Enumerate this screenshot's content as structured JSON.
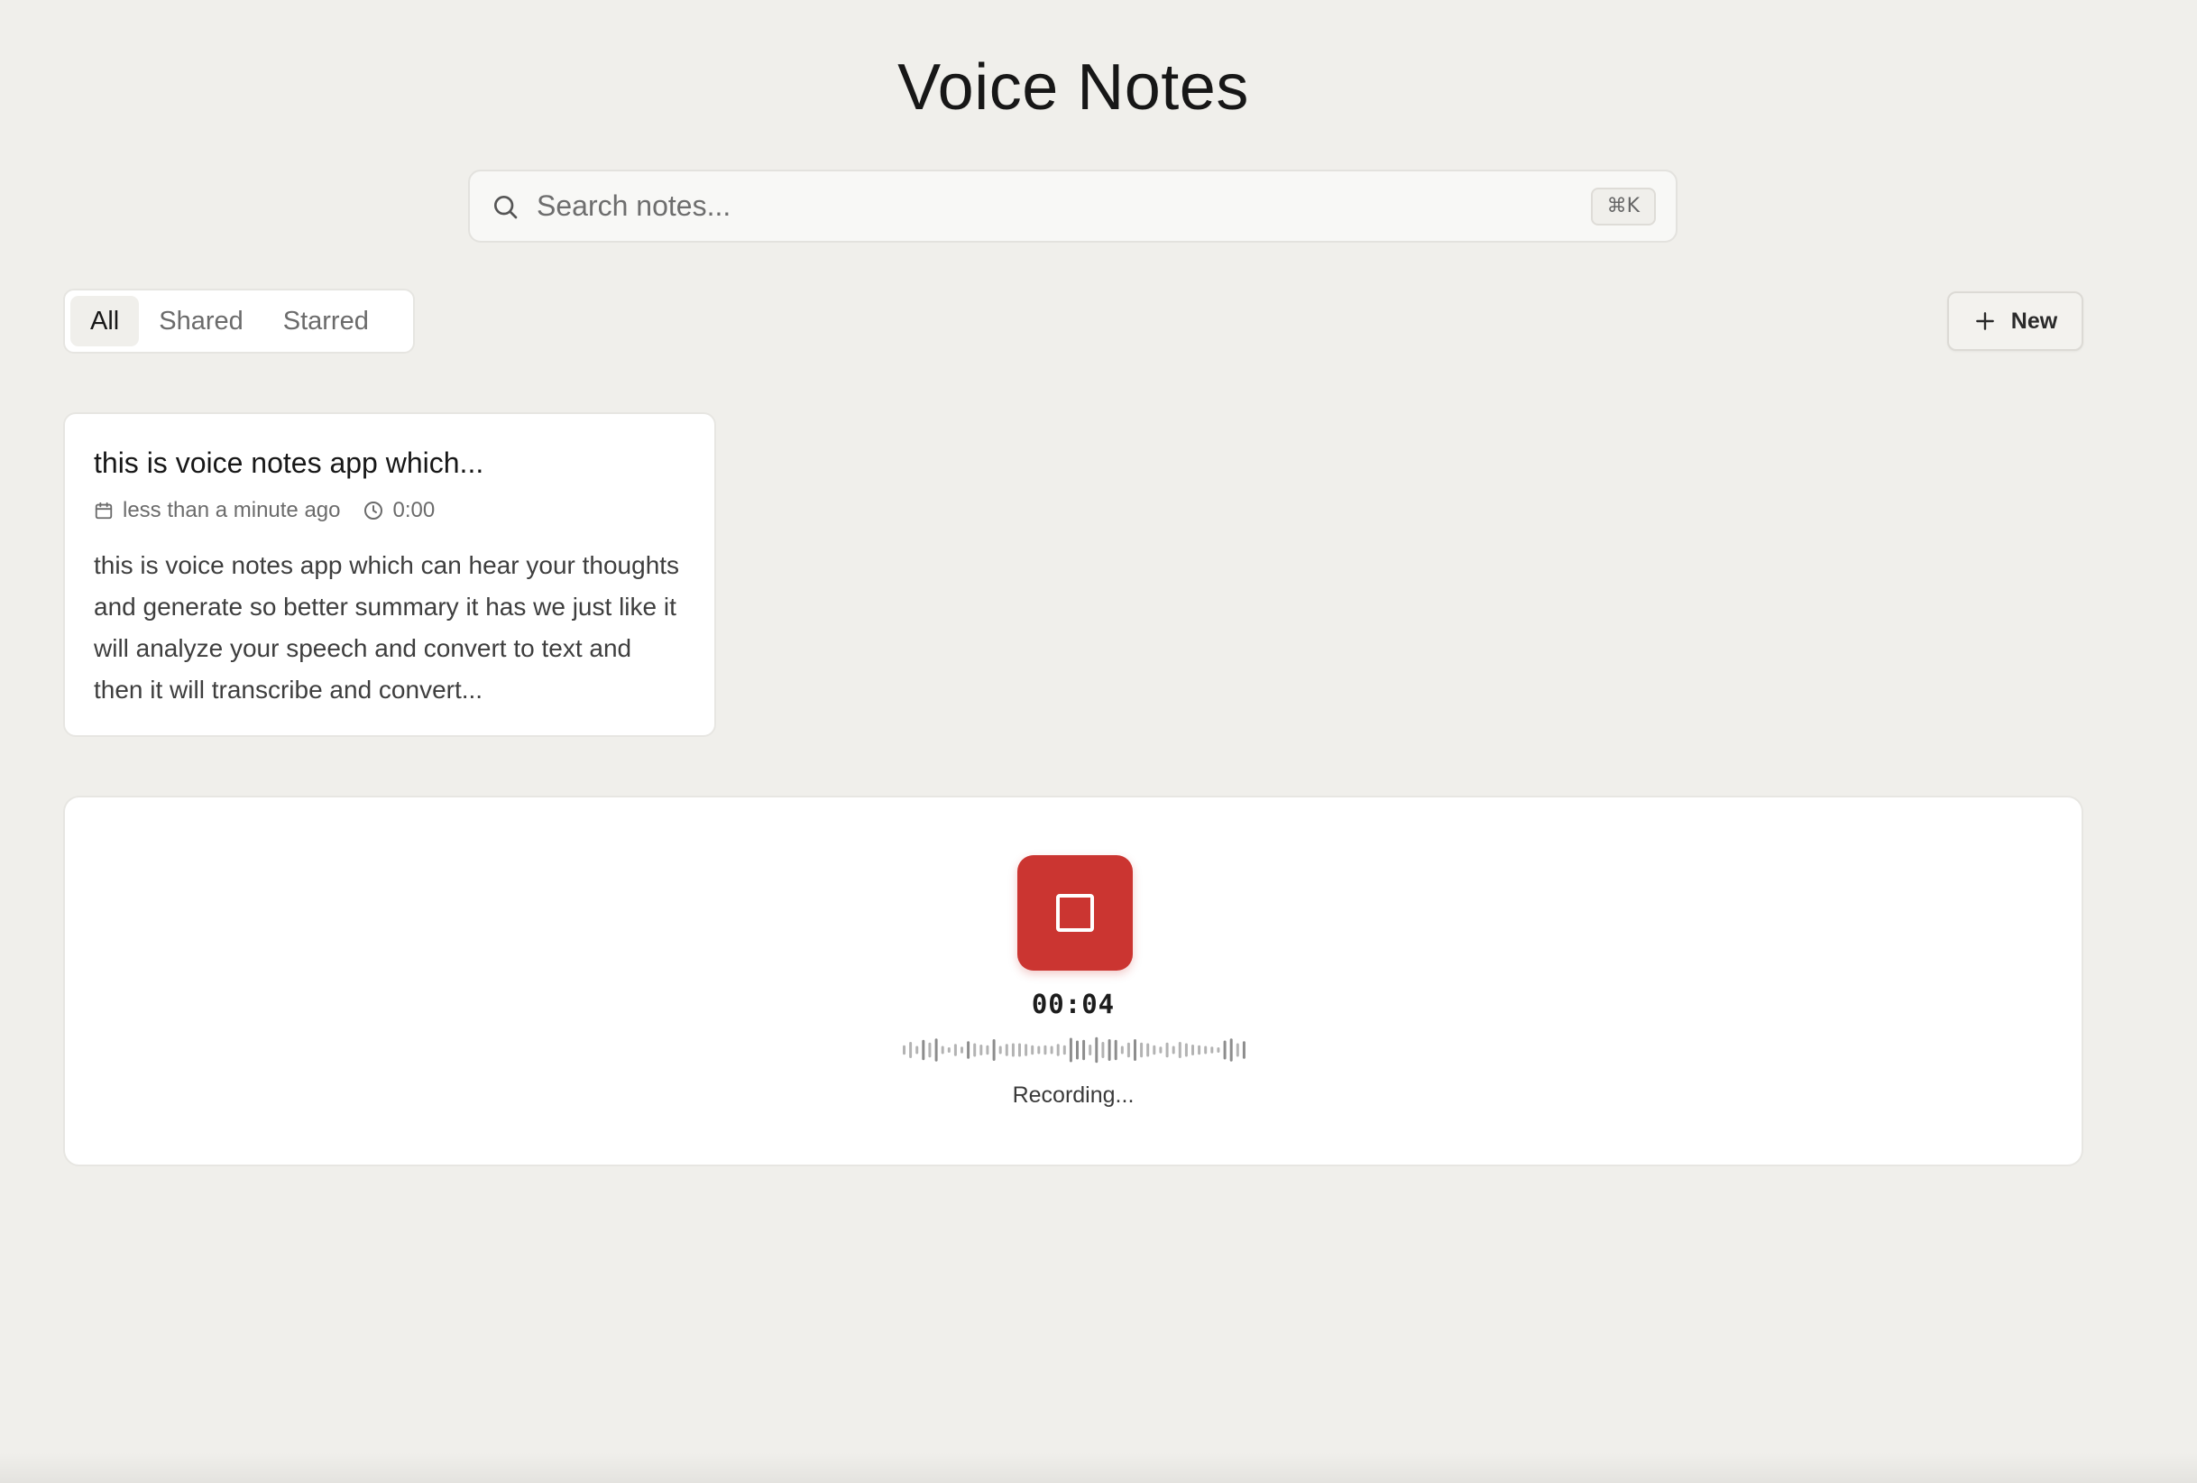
{
  "app": {
    "title": "Voice Notes"
  },
  "search": {
    "placeholder": "Search notes...",
    "value": "",
    "shortcut": "⌘K",
    "icon": "search-icon"
  },
  "filters": {
    "tabs": [
      {
        "label": "All",
        "active": true
      },
      {
        "label": "Shared",
        "active": false
      },
      {
        "label": "Starred",
        "active": false
      }
    ]
  },
  "toolbar": {
    "new_label": "New",
    "new_icon": "plus-icon"
  },
  "notes": [
    {
      "title": "this is voice notes app which...",
      "date": "less than a minute ago",
      "duration": "0:00",
      "preview": "this is voice notes app which can hear your thoughts and generate so better summary it has we just like it will analyze your speech and convert to text and then it will transcribe and convert..."
    }
  ],
  "recorder": {
    "timer": "00:04",
    "status": "Recording...",
    "stop_icon": "stop-icon",
    "accent": "#cb3531",
    "waveform_levels": [
      0.35,
      0.6,
      0.3,
      0.75,
      0.55,
      0.85,
      0.3,
      0.2,
      0.45,
      0.25,
      0.65,
      0.5,
      0.4,
      0.35,
      0.8,
      0.3,
      0.45,
      0.5,
      0.5,
      0.45,
      0.35,
      0.3,
      0.35,
      0.3,
      0.45,
      0.35,
      0.9,
      0.7,
      0.75,
      0.4,
      0.95,
      0.6,
      0.8,
      0.75,
      0.3,
      0.55,
      0.8,
      0.55,
      0.5,
      0.35,
      0.25,
      0.55,
      0.3,
      0.6,
      0.5,
      0.4,
      0.35,
      0.3,
      0.25,
      0.2,
      0.7,
      0.85,
      0.5,
      0.65
    ]
  }
}
